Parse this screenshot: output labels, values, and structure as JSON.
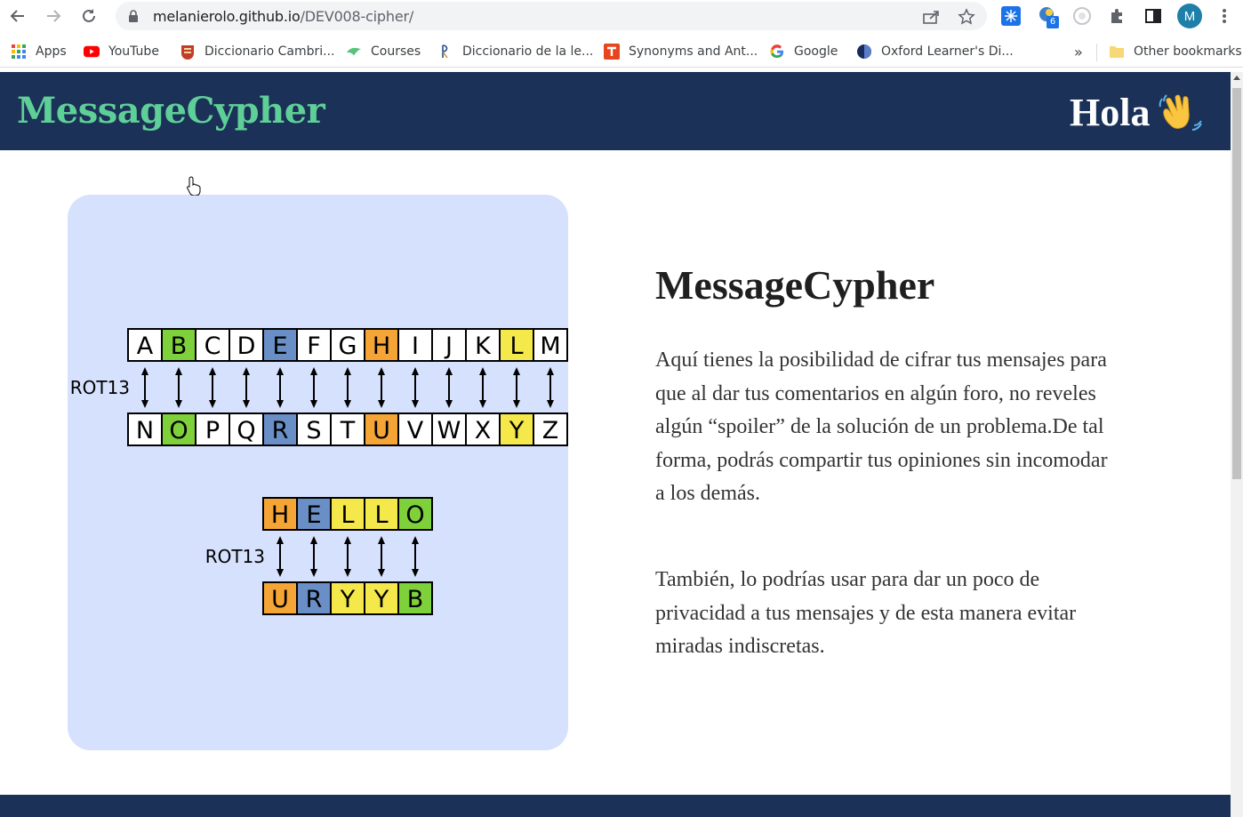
{
  "browser": {
    "url_host": "melanierolo.github.io",
    "url_path": "/DEV008-cipher/",
    "profile_initial": "M",
    "extension_badge": "6",
    "bookmarks": [
      {
        "label": "Apps",
        "icon": "apps-grid-icon"
      },
      {
        "label": "YouTube",
        "icon": "youtube-icon"
      },
      {
        "label": "Diccionario Cambri...",
        "icon": "cambridge-icon"
      },
      {
        "label": "Courses",
        "icon": "courses-icon"
      },
      {
        "label": "Diccionario de la le...",
        "icon": "rae-icon"
      },
      {
        "label": "Synonyms and Ant...",
        "icon": "thesaurus-icon"
      },
      {
        "label": "Google",
        "icon": "google-icon"
      },
      {
        "label": "Oxford Learner's Di...",
        "icon": "oxford-icon"
      }
    ],
    "more_bookmarks": "»",
    "other_bookmarks": "Other bookmarks"
  },
  "header": {
    "brand": "MessageCypher",
    "greeting": "Hola",
    "greeting_emoji": "waving-hand-icon"
  },
  "rot13": {
    "label": "ROT13",
    "top_row": [
      "A",
      "B",
      "C",
      "D",
      "E",
      "F",
      "G",
      "H",
      "I",
      "J",
      "K",
      "L",
      "M"
    ],
    "bottom_row": [
      "N",
      "O",
      "P",
      "Q",
      "R",
      "S",
      "T",
      "U",
      "V",
      "W",
      "X",
      "Y",
      "Z"
    ],
    "highlight": {
      "B": "green",
      "E": "blue",
      "H": "orange",
      "L": "yellow",
      "O": "green",
      "R": "blue",
      "U": "orange",
      "Y": "yellow"
    },
    "word_plain": [
      "H",
      "E",
      "L",
      "L",
      "O"
    ],
    "word_cipher": [
      "U",
      "R",
      "Y",
      "Y",
      "B"
    ],
    "colors": {
      "green": "#7ed13a",
      "blue": "#6a8fc7",
      "orange": "#f5a536",
      "yellow": "#f5e84a"
    }
  },
  "main": {
    "title": "MessageCypher",
    "paragraph1": "Aquí tienes la posibilidad de cifrar tus mensajes para que al dar tus comentarios en algún foro, no reveles algún “spoiler” de la solución de un problema.De tal forma, podrás compartir tus opiniones sin incomodar a los demás.",
    "paragraph2": "También, lo podrías usar para dar un poco de privacidad a tus mensajes y de esta manera evitar miradas indiscretas."
  },
  "colors": {
    "header_bg": "#1b3158",
    "brand": "#5fcf98",
    "card_bg": "#d6e1fd"
  }
}
